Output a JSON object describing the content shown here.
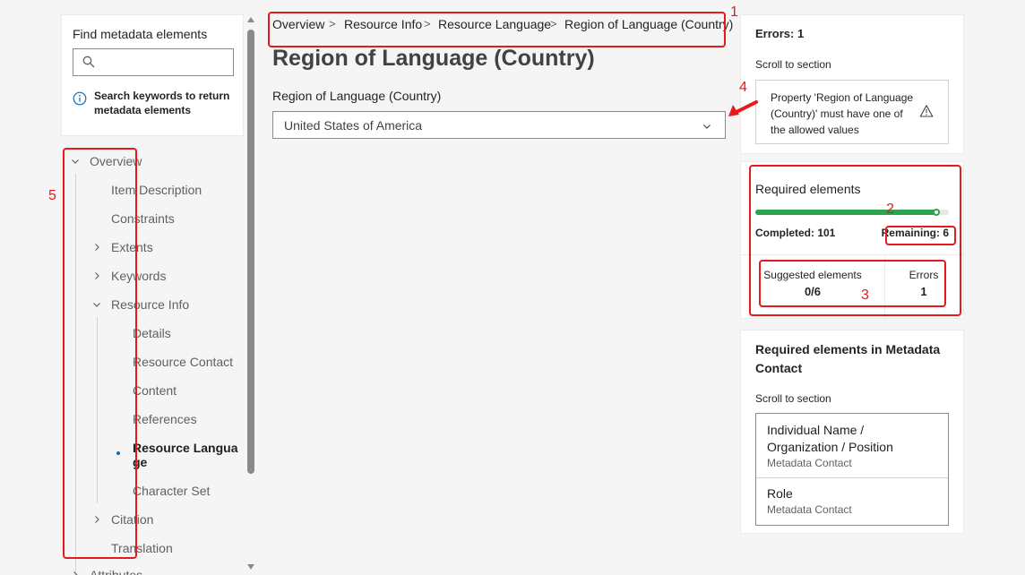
{
  "search": {
    "title": "Find metadata elements",
    "placeholder": "",
    "hint": "Search keywords to return metadata elements"
  },
  "tree": {
    "items": [
      {
        "label": "Overview",
        "expanded": true
      },
      {
        "label": "Item Description"
      },
      {
        "label": "Constraints"
      },
      {
        "label": "Extents",
        "expanded": false
      },
      {
        "label": "Keywords",
        "expanded": false
      },
      {
        "label": "Resource Info",
        "expanded": true
      },
      {
        "label": "Details"
      },
      {
        "label": "Resource Contact"
      },
      {
        "label": "Content"
      },
      {
        "label": "References"
      },
      {
        "label": "Resource Language",
        "active": true
      },
      {
        "label": "Character Set"
      },
      {
        "label": "Citation",
        "expanded": false
      },
      {
        "label": "Translation"
      },
      {
        "label": "Attributes",
        "expanded": false
      }
    ]
  },
  "breadcrumb": {
    "items": [
      "Overview",
      "Resource Info",
      "Resource Language",
      "Region of Language (Country)"
    ],
    "separator": ">"
  },
  "main": {
    "title": "Region of Language (Country)",
    "field_label": "Region of Language (Country)",
    "field_value": "United States of America"
  },
  "errors_card": {
    "title": "Errors: 1",
    "scroll_label": "Scroll to section",
    "message": "Property 'Region of Language (Country)' must have one of the allowed values",
    "icon": "warning-icon"
  },
  "required": {
    "title": "Required elements",
    "completed_label": "Completed: 101",
    "remaining_label": "Remaining: 6",
    "progress_fraction": 0.944,
    "progress_color": "#2da44e",
    "suggested_label": "Suggested elements",
    "suggested_value": "0/6",
    "errors_label": "Errors",
    "errors_value": "1"
  },
  "contact": {
    "title": "Required elements in Metadata Contact",
    "scroll_label": "Scroll to section",
    "items": [
      {
        "name": "Individual Name / Organization / Position",
        "section": "Metadata Contact"
      },
      {
        "name": "Role",
        "section": "Metadata Contact"
      }
    ]
  },
  "annotations": {
    "labels": [
      "1",
      "2",
      "3",
      "4",
      "5"
    ],
    "color": "#e8191c"
  }
}
